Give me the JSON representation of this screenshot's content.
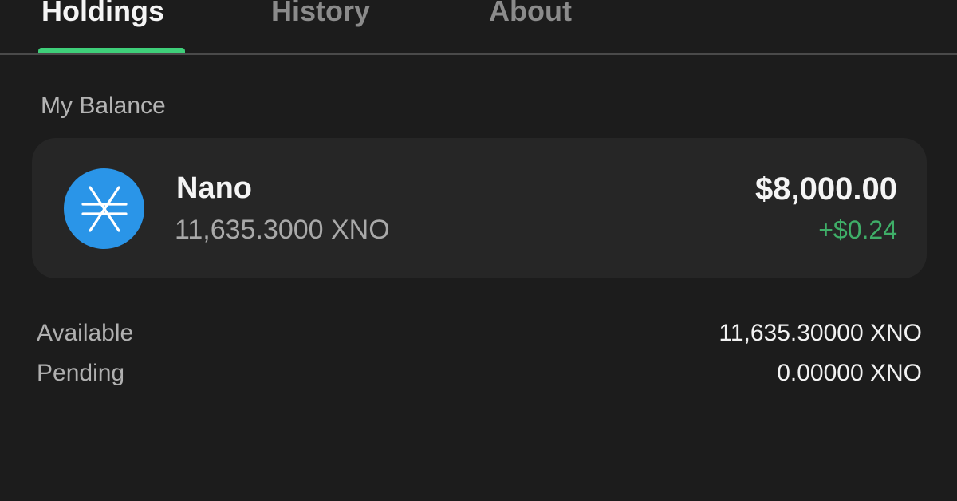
{
  "tabs": [
    {
      "label": "Holdings",
      "active": true
    },
    {
      "label": "History",
      "active": false
    },
    {
      "label": "About",
      "active": false
    }
  ],
  "colors": {
    "background": "#1c1c1c",
    "card": "#262626",
    "accent": "#3fcf7a",
    "positive": "#3fae68",
    "coin_icon": "#2a95e8"
  },
  "balance_section": {
    "title": "My Balance"
  },
  "asset": {
    "icon": "nano-xno-icon",
    "name": "Nano",
    "amount": "11,635.3000 XNO",
    "fiat_value": "$8,000.00",
    "fiat_change": "+$0.24"
  },
  "details": {
    "available": {
      "label": "Available",
      "value": "11,635.30000 XNO"
    },
    "pending": {
      "label": "Pending",
      "value": "0.00000 XNO"
    }
  }
}
